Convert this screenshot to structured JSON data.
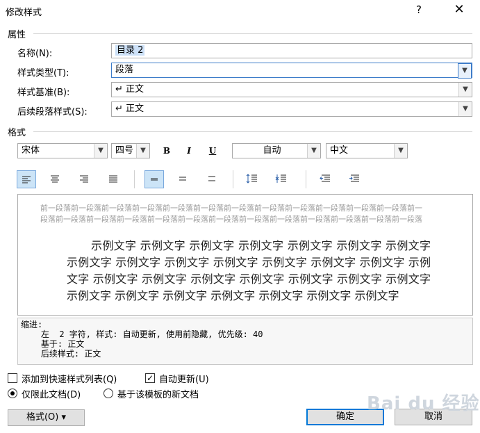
{
  "window": {
    "title": "修改样式",
    "help": "?",
    "close": "✕"
  },
  "properties": {
    "section": "属性",
    "name_label": "名称(N):",
    "name_value": "目录 2",
    "type_label": "样式类型(T):",
    "type_value": "段落",
    "based_label": "样式基准(B):",
    "based_value": "↵ 正文",
    "next_label": "后续段落样式(S):",
    "next_value": "↵ 正文"
  },
  "format": {
    "section": "格式",
    "font": "宋体",
    "size": "四号",
    "bold": "B",
    "italic": "I",
    "underline": "U",
    "color": "自动",
    "lang": "中文"
  },
  "preview": {
    "prev_text": "前一段落前一段落前一段落前一段落前一段落前一段落前一段落前一段落前一段落前一段落前一段落前一段落前一段落前一段落前一段落前一段落前一段落前一段落前一段落前一段落前一段落前一段落前一段落前一段落前一段落",
    "sample_text": "示例文字 示例文字 示例文字 示例文字 示例文字 示例文字 示例文字 示例文字 示例文字 示例文字 示例文字 示例文字 示例文字 示例文字 示例文字 示例文字 示例文字 示例文字 示例文字 示例文字 示例文字 示例文字 示例文字 示例文字 示例文字 示例文字 示例文字 示例文字 示例文字"
  },
  "description": "缩进:\n    左  2 字符, 样式: 自动更新, 使用前隐藏, 优先级: 40\n    基于: 正文\n    后续样式: 正文",
  "options": {
    "add_to_gallery": "添加到快速样式列表(Q)",
    "auto_update": "自动更新(U)",
    "this_doc_only": "仅限此文档(D)",
    "new_docs": "基于该模板的新文档"
  },
  "buttons": {
    "format": "格式(O) ▾",
    "ok": "确定",
    "cancel": "取消"
  },
  "watermark": "Bai du 经验"
}
